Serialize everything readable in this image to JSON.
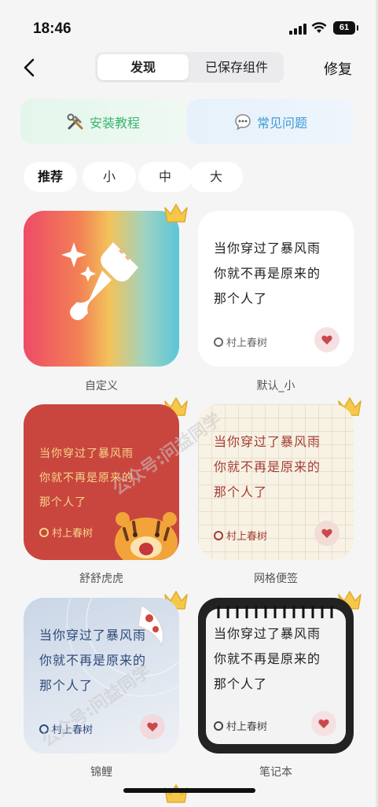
{
  "status_bar": {
    "time": "18:46",
    "battery": "61"
  },
  "nav": {
    "tab_discover": "发现",
    "tab_saved": "已保存组件",
    "repair": "修复"
  },
  "banners": {
    "install": "安装教程",
    "faq": "常见问题"
  },
  "filters": [
    "推荐",
    "小",
    "中",
    "大"
  ],
  "quote": {
    "line1": "当你穿过了暴风雨",
    "line2": "你就不再是原来的",
    "line3": "那个人了",
    "author": "村上春树"
  },
  "widgets": [
    "自定义",
    "默认_小",
    "舒舒虎虎",
    "网格便签",
    "锦鲤",
    "笔记本"
  ],
  "watermark": {
    "text1": "公众号:问益同学",
    "text2": "公众号:问益同学"
  },
  "colors": {
    "accent_green": "#3bb470",
    "accent_blue": "#3e9ad8",
    "heart": "#c9484e"
  }
}
